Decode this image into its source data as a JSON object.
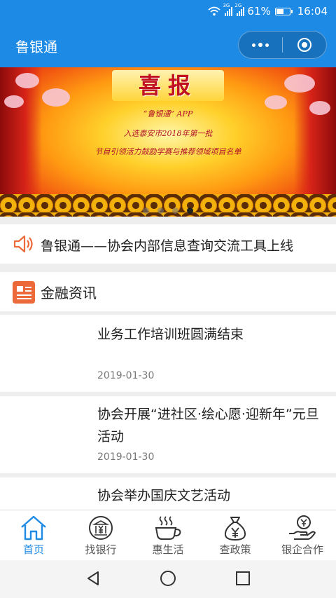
{
  "status_bar": {
    "network_1": "3G",
    "network_2": "2G",
    "battery": "61%",
    "battery_level": 0.61,
    "time": "16:04"
  },
  "title_bar": {
    "title": "鲁银通",
    "more_icon": "more-dots-icon",
    "close_icon": "target-circle-icon"
  },
  "banner": {
    "heading": "喜报",
    "lines": [
      "“鲁银通” APP",
      "入选泰安市2018年第一批",
      "节目引领活力鼓励学赛与推荐领域项目名单"
    ],
    "slide_count": 4,
    "active_slide": 4
  },
  "notice": {
    "icon": "speaker-icon",
    "text": "鲁银通——协会内部信息查询交流工具上线"
  },
  "section": {
    "icon": "news-icon",
    "title": "金融资讯"
  },
  "news": [
    {
      "title": "业务工作培训班圆满结束",
      "date": "2019-01-30"
    },
    {
      "title": "协会开展“进社区·绘心愿·迎新年”元旦活动",
      "date": "2019-01-30"
    },
    {
      "title": "协会举办国庆文艺活动",
      "date": ""
    }
  ],
  "tabs": [
    {
      "label": "首页",
      "icon": "home-icon",
      "active": true
    },
    {
      "label": "找银行",
      "icon": "bank-yen-icon",
      "active": false
    },
    {
      "label": "惠生活",
      "icon": "coffee-cup-icon",
      "active": false
    },
    {
      "label": "查政策",
      "icon": "money-bag-icon",
      "active": false
    },
    {
      "label": "银企合作",
      "icon": "hand-coin-icon",
      "active": false
    }
  ],
  "colors": {
    "brand": "#1d8ae6",
    "accent": "#ec6a3a",
    "text": "#222222",
    "muted": "#777777"
  }
}
